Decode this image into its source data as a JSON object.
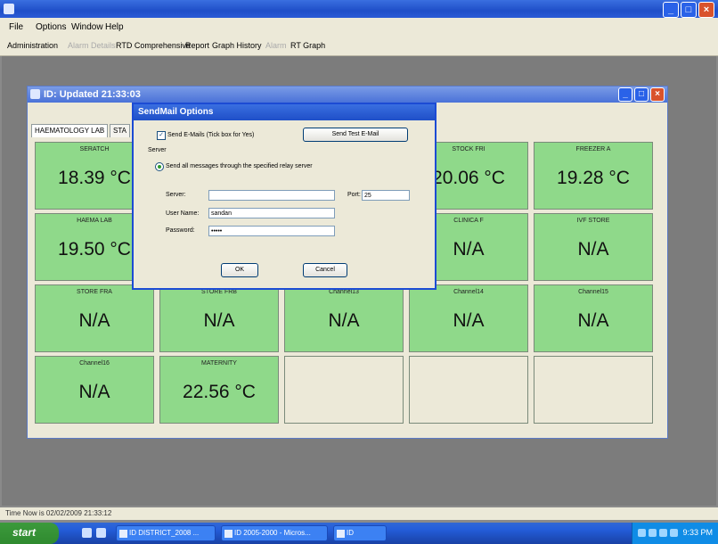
{
  "app": {
    "title": ""
  },
  "menu": [
    "File",
    "Options",
    "Window",
    "Help"
  ],
  "toolbar": [
    {
      "label": "Administration",
      "dim": false
    },
    {
      "label": "Alarm Details",
      "dim": true
    },
    {
      "label": "RTD Comprehensive",
      "dim": false
    },
    {
      "label": "Report",
      "dim": false
    },
    {
      "label": "Graph History",
      "dim": false
    },
    {
      "label": "Alarm",
      "dim": true
    },
    {
      "label": "RT Graph",
      "dim": false
    }
  ],
  "frame": {
    "title": "ID: Updated 21:33:03",
    "tabs": [
      "HAEMATOLOGY LAB",
      "STA"
    ]
  },
  "sensors": [
    {
      "name": "SERATCH",
      "value": "18.39 °C"
    },
    {
      "name": "",
      "value": ""
    },
    {
      "name": "",
      "value": ""
    },
    {
      "name": "STOCK FRI",
      "value": "20.06 °C"
    },
    {
      "name": "FREEZER A",
      "value": "19.28 °C"
    },
    {
      "name": "HAEMA LAB",
      "value": "19.50 °C"
    },
    {
      "name": "",
      "value": ""
    },
    {
      "name": "",
      "value": ""
    },
    {
      "name": "CLINICA F",
      "value": "N/A"
    },
    {
      "name": "IVF STORE",
      "value": "N/A"
    },
    {
      "name": "STORE FRA",
      "value": "N/A"
    },
    {
      "name": "STORE FRB",
      "value": "N/A"
    },
    {
      "name": "Channel13",
      "value": "N/A"
    },
    {
      "name": "Channel14",
      "value": "N/A"
    },
    {
      "name": "Channel15",
      "value": "N/A"
    },
    {
      "name": "Channel16",
      "value": "N/A"
    },
    {
      "name": "MATERNITY",
      "value": "22.56 °C"
    }
  ],
  "dialog": {
    "title": "SendMail Options",
    "send_email_label": "Send E-Mails (Tick box for Yes)",
    "send_test_button": "Send Test E-Mail",
    "server_section": "Server",
    "send_all_label": "Send all messages through the specified relay server",
    "server_label": "Server:",
    "server_value": "",
    "port_label": "Port:",
    "port_value": "25",
    "username_label": "User Name:",
    "username_value": "sandan",
    "password_label": "Password:",
    "password_value": "•••••",
    "ok_button": "OK",
    "cancel_button": "Cancel"
  },
  "status": "Time Now is 02/02/2009 21:33:12",
  "taskbar": {
    "start": "start",
    "tasks": [
      "ID DISTRICT_2008 ...",
      "ID 2005-2000 - Micros...",
      "ID"
    ],
    "clock": "9:33 PM"
  },
  "colors": {
    "cell_green": "#8fd98a",
    "titlebar_blue": "#1f4fc8"
  }
}
